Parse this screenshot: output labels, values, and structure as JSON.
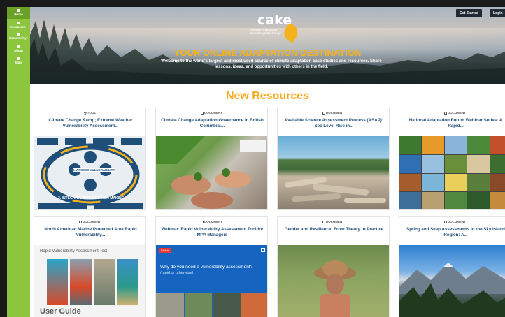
{
  "sidebar": {
    "items": [
      {
        "label": "Home"
      },
      {
        "label": "Resources ›"
      },
      {
        "label": "Community ›"
      },
      {
        "label": "About"
      },
      {
        "label": "Map"
      }
    ]
  },
  "header": {
    "get_started": "Get Started",
    "login": "Login"
  },
  "logo": {
    "word": "cake",
    "tagline": "Climate Adaptation Knowledge Exchange"
  },
  "hero": {
    "title": "YOUR ONLINE ADAPTATION DESTINATION",
    "subtitle": "Welcome to the world's largest and most used source of climate adaptation case studies and resources. Share lessons, ideas, and opportunities with others in the field."
  },
  "section": {
    "title": "New Resources"
  },
  "cards": [
    {
      "type": "TOOL",
      "title": "Climate Change &amp; Extreme Weather Vulnerability Assessment..."
    },
    {
      "type": "DOCUMENT",
      "title": "Climate Change Adaptation Governance in British Columbia:..."
    },
    {
      "type": "DOCUMENT",
      "title": "Available Science Assessment Process (ASAP): Sea Level Rise in..."
    },
    {
      "type": "DOCUMENT",
      "title": "National Adaptation Forum Webinar Series: A Rapid..."
    },
    {
      "type": "DOCUMENT",
      "title": "North American Marine Protected Area Rapid Vulnerability..."
    },
    {
      "type": "DOCUMENT",
      "title": "Webinar: Rapid Vulnerability Assessment Tool for MPA Managers"
    },
    {
      "type": "DOCUMENT",
      "title": "Gender and Resilience: From Theory to Practice"
    },
    {
      "type": "DOCUMENT",
      "title": "Spring and Seep Assessments in the Sky Island Region: A..."
    }
  ],
  "card1_diagram": {
    "assess": "2. ASSESS VULNERABILITY",
    "integrate": "3. INTEGRATE INTO DECISION MAKING"
  },
  "card5_guide": {
    "heading": "Rapid Vulnerability Assessment Tool",
    "user_guide": "User Guide"
  },
  "card6_video": {
    "tag": "Watch",
    "question": "Why do you need a vulnerability assessment?",
    "sub": "(rapid or otherwise)"
  }
}
